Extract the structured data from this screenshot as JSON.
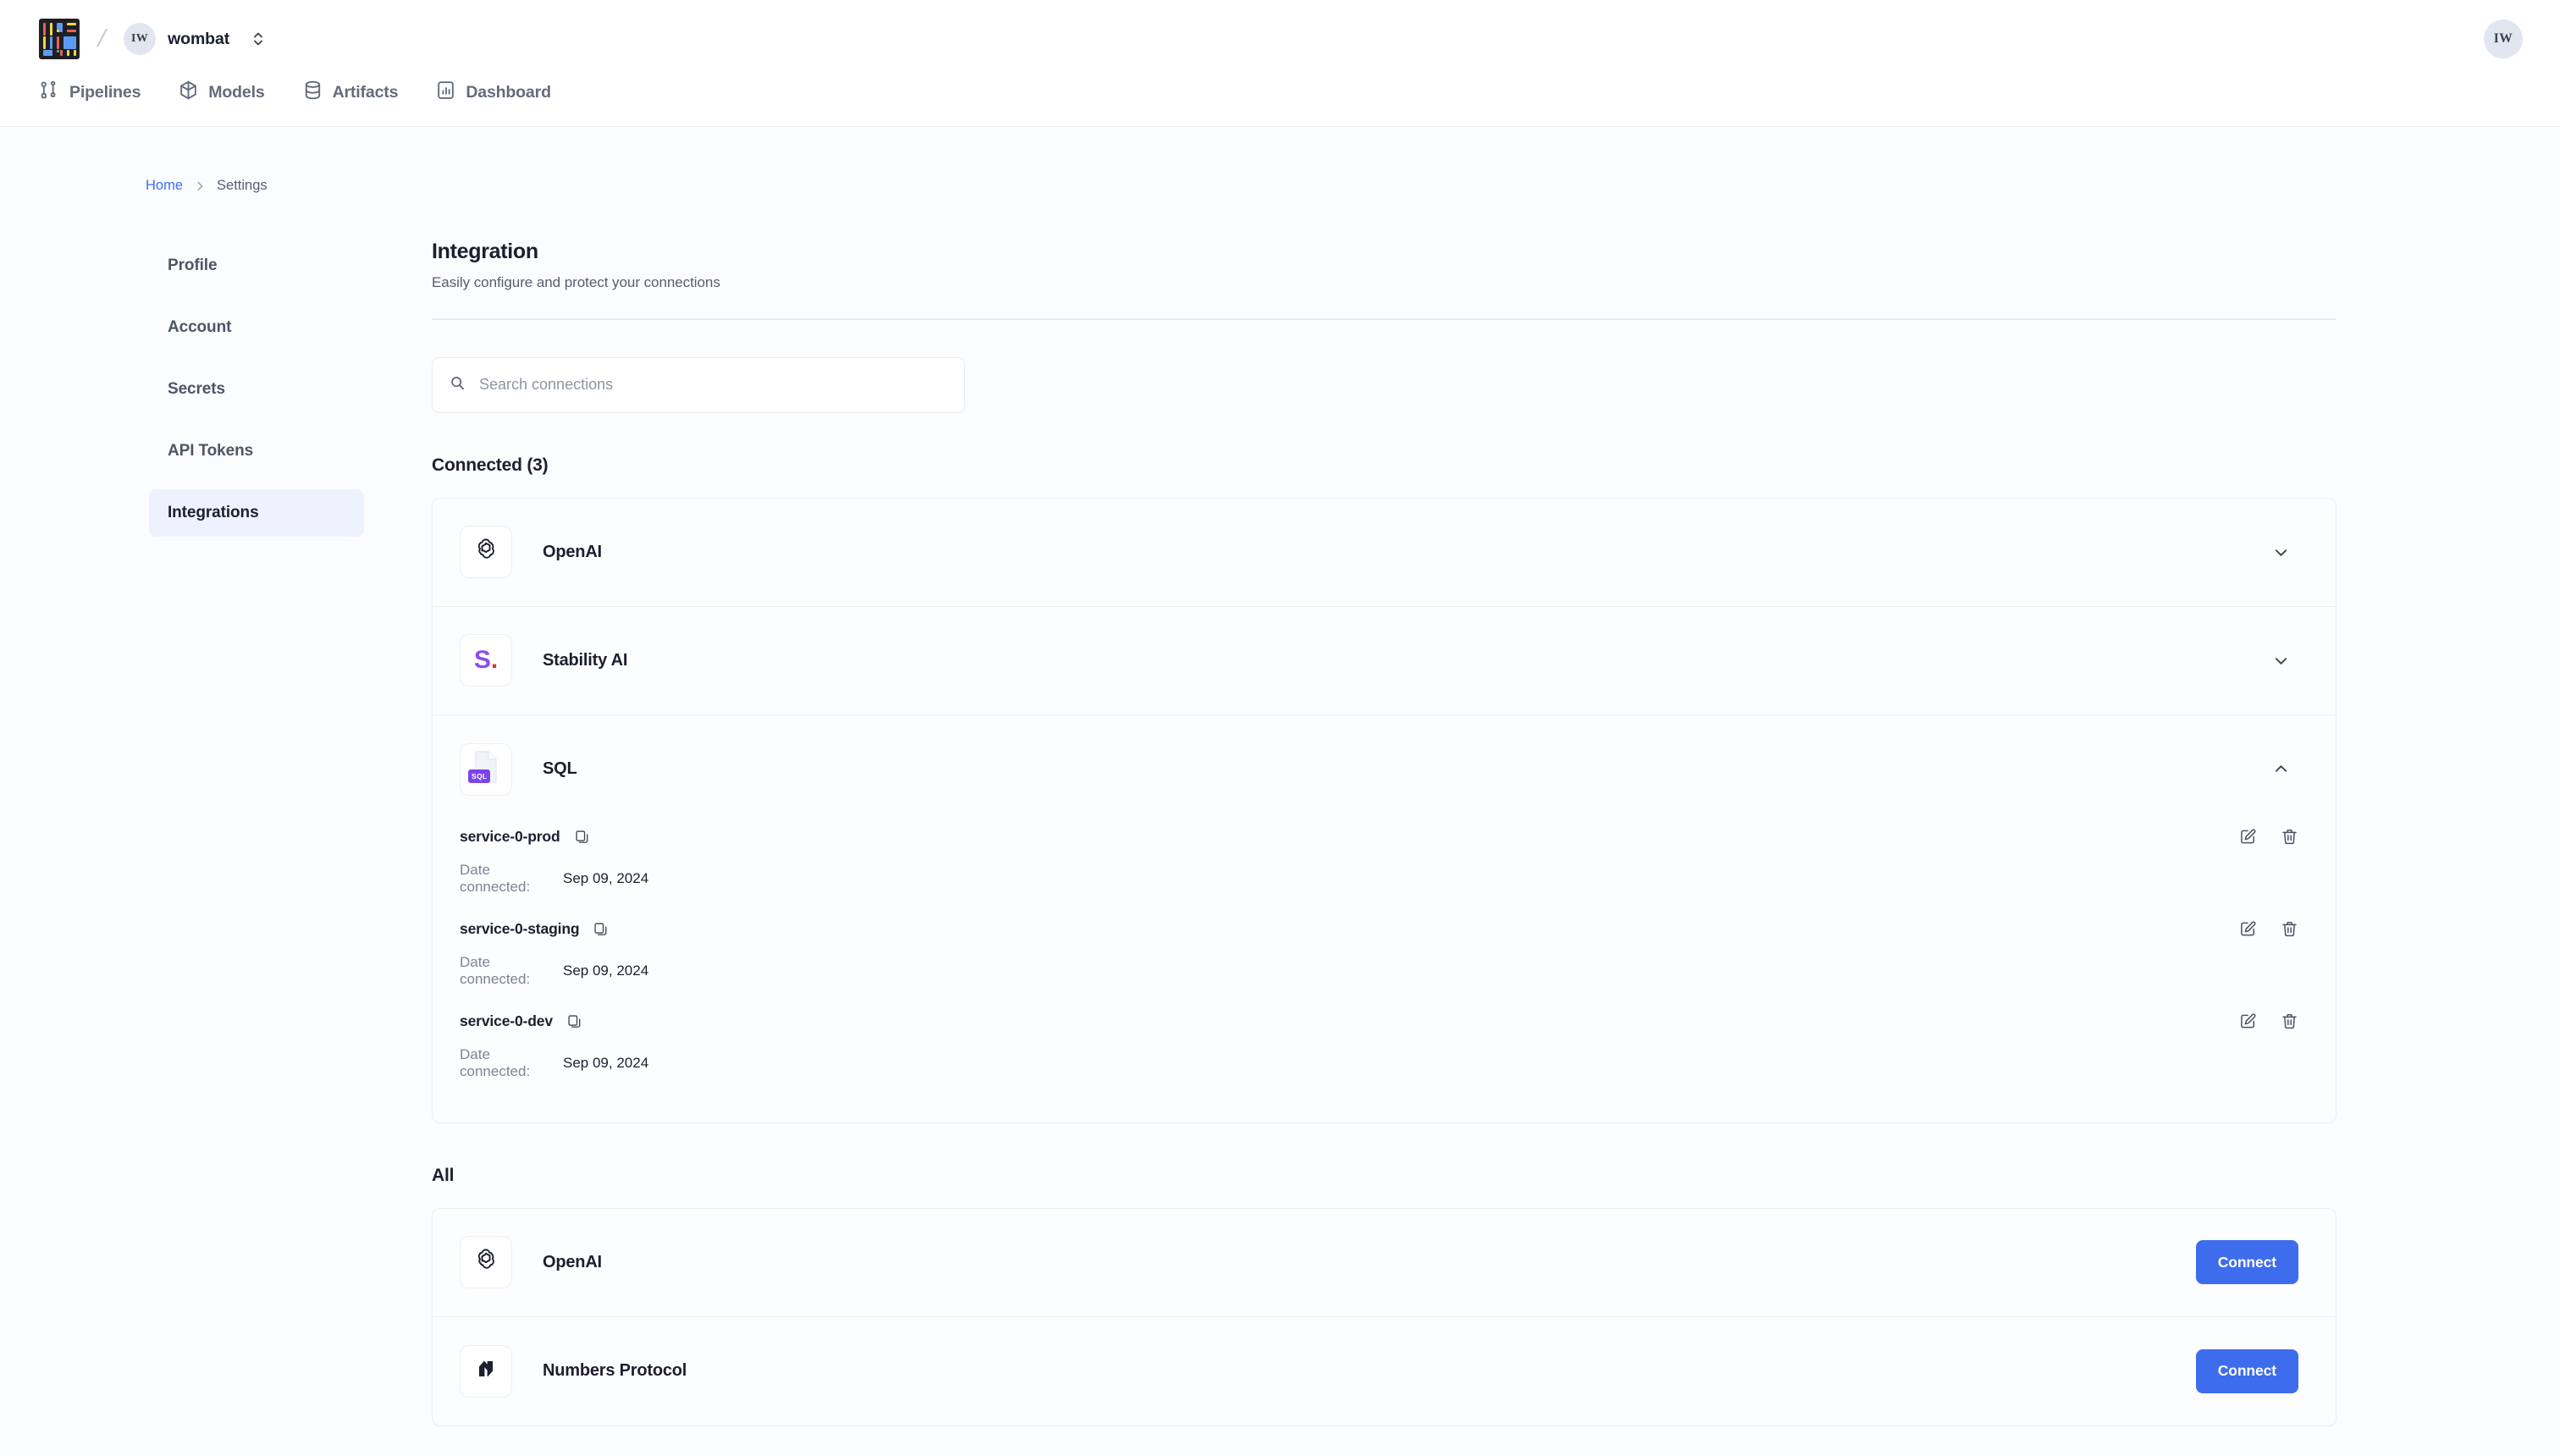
{
  "topbar": {
    "workspace_initials": "IW",
    "workspace_name": "wombat",
    "user_initials": "IW",
    "logo_name": "app-logo"
  },
  "nav": {
    "items": [
      {
        "label": "Pipelines",
        "icon": "pipelines-icon"
      },
      {
        "label": "Models",
        "icon": "models-icon"
      },
      {
        "label": "Artifacts",
        "icon": "artifacts-icon"
      },
      {
        "label": "Dashboard",
        "icon": "dashboard-icon"
      }
    ]
  },
  "breadcrumb": {
    "home": "Home",
    "current": "Settings"
  },
  "sidebar": {
    "items": [
      {
        "label": "Profile",
        "active": false
      },
      {
        "label": "Account",
        "active": false
      },
      {
        "label": "Secrets",
        "active": false
      },
      {
        "label": "API Tokens",
        "active": false
      },
      {
        "label": "Integrations",
        "active": true
      }
    ]
  },
  "main": {
    "title": "Integration",
    "subtitle": "Easily configure and protect your connections",
    "search_placeholder": "Search connections",
    "search_value": "",
    "connected_heading": "Connected (3)",
    "all_heading": "All",
    "connected": [
      {
        "name": "OpenAI",
        "icon": "openai-logo",
        "expanded": false
      },
      {
        "name": "Stability AI",
        "icon": "stability-ai-logo",
        "expanded": false
      },
      {
        "name": "SQL",
        "icon": "sql-file-logo",
        "expanded": true
      }
    ],
    "sql_services": [
      {
        "name": "service-0-prod",
        "date_label": "Date connected:",
        "date_value": "Sep 09, 2024"
      },
      {
        "name": "service-0-staging",
        "date_label": "Date connected:",
        "date_value": "Sep 09, 2024"
      },
      {
        "name": "service-0-dev",
        "date_label": "Date connected:",
        "date_value": "Sep 09, 2024"
      }
    ],
    "all": [
      {
        "name": "OpenAI",
        "icon": "openai-logo",
        "button": "Connect"
      },
      {
        "name": "Numbers Protocol",
        "icon": "numbers-protocol-logo",
        "button": "Connect"
      }
    ]
  },
  "colors": {
    "accent_blue": "#3d6ded",
    "link_blue": "#3b6ef5",
    "active_nav_bg": "#eef2fe",
    "text_dark": "#1b2030",
    "purple": "#7c45ec"
  }
}
